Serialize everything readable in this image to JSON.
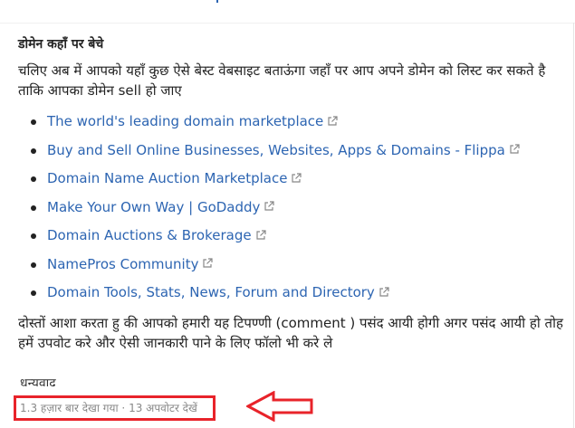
{
  "header": {
    "title": "डोमेन कहाँ पर बेचे"
  },
  "intro": "चलिए अब में आपको यहाँ कुछ ऐसे बेस्ट वेबसाइट बताऊंगा जहाँ पर आप अपने डोमेन को लिस्ट कर सकते है ताकि आपका डोमेन sell हो जाए",
  "links": [
    {
      "label": "The world's leading domain marketplace"
    },
    {
      "label": "Buy and Sell Online Businesses, Websites, Apps & Domains - Flippa"
    },
    {
      "label": "Domain Name Auction Marketplace"
    },
    {
      "label": "Make Your Own Way | GoDaddy"
    },
    {
      "label": "Domain Auctions & Brokerage"
    },
    {
      "label": "NamePros Community"
    },
    {
      "label": "Domain Tools, Stats, News, Forum and Directory"
    }
  ],
  "outro": "दोस्तों आशा करता हु की आपको हमारी यह टिपण्णी (comment ) पसंद आयी होगी अगर पसंद आयी हो तोह हमें उपवोट करे और ऐसी जानकारी पाने के लिए फॉलो भी करे ले",
  "thanks": "धन्यवाद",
  "stats": {
    "views_text": "1.3 हज़ार बार देखा गया · 13 अपवोटर देखें"
  },
  "colors": {
    "link": "#2d65b2",
    "highlight": "#e8232a"
  },
  "icons": {
    "external": "external-link-icon",
    "arrow": "arrow-left-icon"
  }
}
